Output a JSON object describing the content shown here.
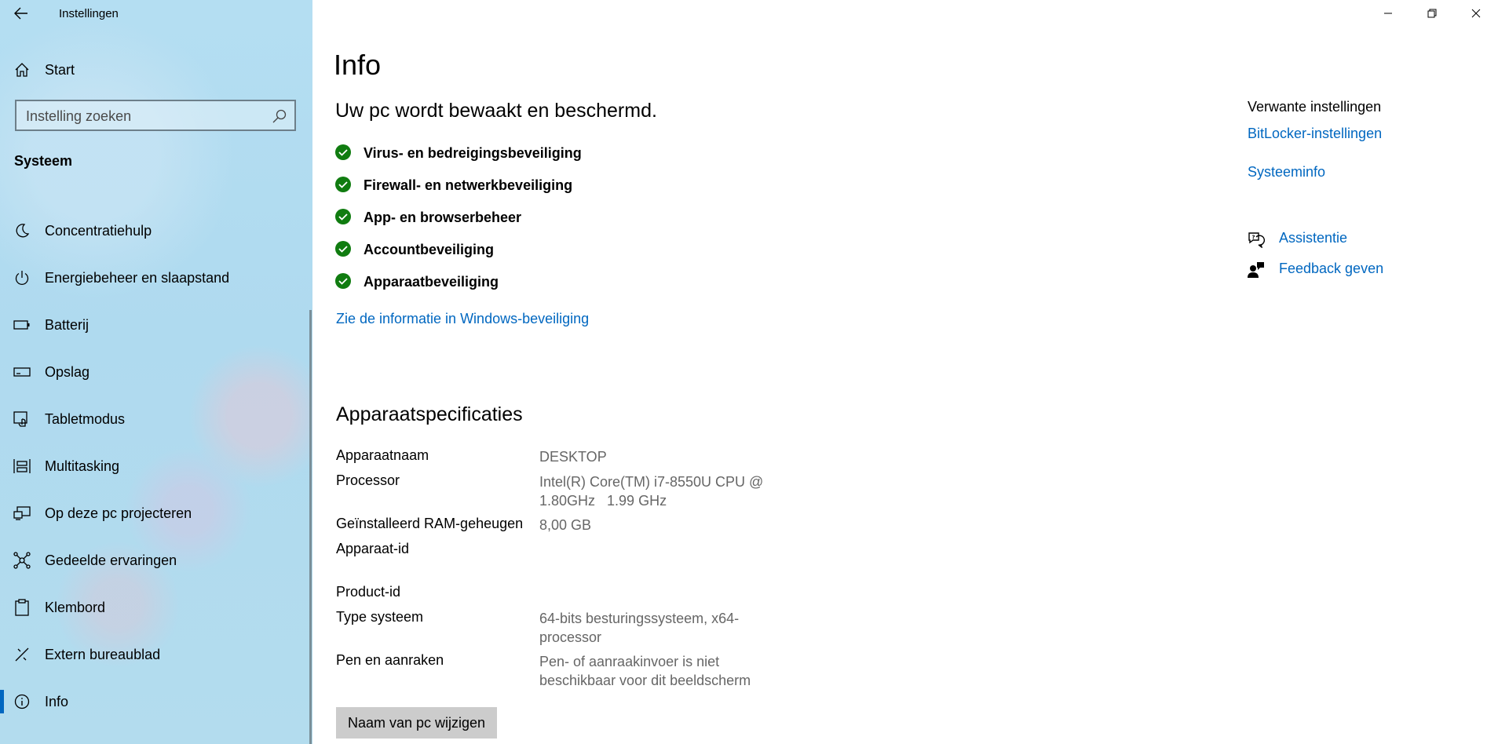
{
  "window": {
    "app_title": "Instellingen",
    "controls": [
      "minimize-icon",
      "restore-icon",
      "close-icon"
    ]
  },
  "sidebar": {
    "home_label": "Start",
    "search_placeholder": "Instelling zoeken",
    "section_title": "Systeem",
    "items": [
      {
        "label": "Concentratiehulp",
        "icon": "moon-icon"
      },
      {
        "label": "Energiebeheer en slaapstand",
        "icon": "power-icon"
      },
      {
        "label": "Batterij",
        "icon": "battery-icon"
      },
      {
        "label": "Opslag",
        "icon": "storage-icon"
      },
      {
        "label": "Tabletmodus",
        "icon": "tablet-mode-icon"
      },
      {
        "label": "Multitasking",
        "icon": "multitasking-icon"
      },
      {
        "label": "Op deze pc projecteren",
        "icon": "project-icon"
      },
      {
        "label": "Gedeelde ervaringen",
        "icon": "shared-experiences-icon"
      },
      {
        "label": "Klembord",
        "icon": "clipboard-icon"
      },
      {
        "label": "Extern bureaublad",
        "icon": "remote-desktop-icon"
      },
      {
        "label": "Info",
        "icon": "info-icon",
        "selected": true
      }
    ]
  },
  "main": {
    "title": "Info",
    "status_heading": "Uw pc wordt bewaakt en beschermd.",
    "security_items": [
      "Virus- en bedreigingsbeveiliging",
      "Firewall- en netwerkbeveiliging",
      "App- en browserbeheer",
      "Accountbeveiliging",
      "Apparaatbeveiliging"
    ],
    "security_link": "Zie de informatie in Windows-beveiliging",
    "specs_title": "Apparaatspecificaties",
    "specs": [
      {
        "key": "Apparaatnaam",
        "value": "DESKTOP"
      },
      {
        "key": "Processor",
        "value": "Intel(R) Core(TM) i7-8550U CPU @ 1.80GHz   1.99 GHz"
      },
      {
        "key": "Geïnstalleerd RAM-geheugen",
        "value": "8,00 GB"
      },
      {
        "key": "Apparaat-id",
        "value": ""
      },
      {
        "key": "Product-id",
        "value": ""
      },
      {
        "key": "Type systeem",
        "value": "64-bits besturingssysteem, x64-processor"
      },
      {
        "key": "Pen en aanraken",
        "value": "Pen- of aanraakinvoer is niet beschikbaar voor dit beeldscherm"
      }
    ],
    "rename_button": "Naam van pc wijzigen"
  },
  "related": {
    "title": "Verwante instellingen",
    "links": [
      "BitLocker-instellingen",
      "Systeeminfo"
    ],
    "help": [
      {
        "label": "Assistentie",
        "icon": "help-chat-icon"
      },
      {
        "label": "Feedback geven",
        "icon": "feedback-icon"
      }
    ]
  },
  "colors": {
    "accent": "#0067c0",
    "check_green": "#107c10",
    "sidebar_bg": "#b6dff0",
    "button_bg": "#cccccc"
  }
}
